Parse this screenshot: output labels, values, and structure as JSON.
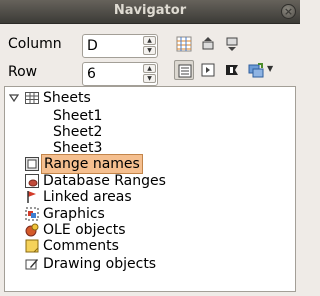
{
  "window": {
    "title": "Navigator",
    "close_glyph": "×"
  },
  "fields": {
    "column_label": "Column",
    "column_value": "D",
    "row_label": "Row",
    "row_value": "6"
  },
  "toolbar": {
    "icons": [
      "data-range-icon",
      "start-icon",
      "end-icon",
      "contents-icon",
      "toggle-icon",
      "scenarios-icon",
      "drag-mode-icon",
      "dropdown-arrow-icon"
    ]
  },
  "tree": {
    "sheets_label": "Sheets",
    "sheets": [
      "Sheet1",
      "Sheet2",
      "Sheet3"
    ],
    "categories": [
      {
        "label": "Range names",
        "icon": "range-names-icon",
        "selected": true
      },
      {
        "label": "Database Ranges",
        "icon": "database-ranges-icon",
        "selected": false
      },
      {
        "label": "Linked areas",
        "icon": "linked-areas-icon",
        "selected": false
      },
      {
        "label": "Graphics",
        "icon": "graphics-icon",
        "selected": false
      },
      {
        "label": "OLE objects",
        "icon": "ole-objects-icon",
        "selected": false
      },
      {
        "label": "Comments",
        "icon": "comments-icon",
        "selected": false
      },
      {
        "label": "Drawing objects",
        "icon": "drawing-objects-icon",
        "selected": false
      }
    ]
  },
  "colors": {
    "selection": "#f5bf8f",
    "titlebar": "#3c3b37"
  }
}
